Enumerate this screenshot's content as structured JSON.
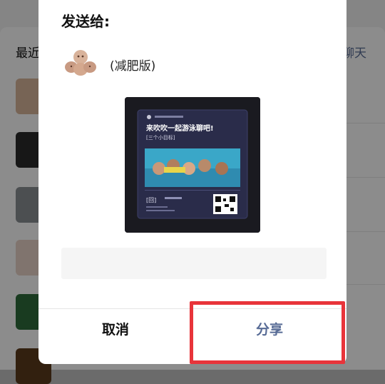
{
  "background": {
    "section_title": "最近",
    "link_text": "聊天"
  },
  "dialog": {
    "title": "发送给:",
    "recipient": {
      "name": "(减肥版)",
      "avatar_icon": "clay-figure-avatar-icon"
    },
    "preview": {
      "headline": "来吹吹一起游泳聊吧!",
      "subline": "[三个小目标]",
      "brand": "[回]"
    },
    "comment_placeholder": "",
    "buttons": {
      "cancel": "取消",
      "share": "分享"
    }
  },
  "colors": {
    "accent": "#576b95",
    "highlight": "#e8343a"
  }
}
